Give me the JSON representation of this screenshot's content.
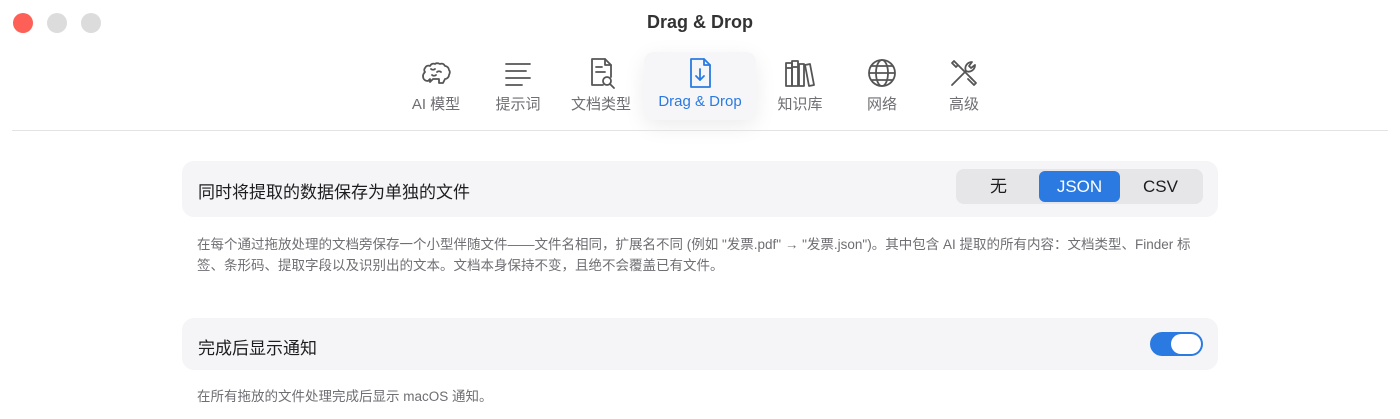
{
  "window": {
    "title": "Drag & Drop"
  },
  "tabs": [
    {
      "label": "AI 模型",
      "icon": "brain-icon",
      "active": false
    },
    {
      "label": "提示词",
      "icon": "text-lines-icon",
      "active": false
    },
    {
      "label": "文档类型",
      "icon": "document-search-icon",
      "active": false
    },
    {
      "label": "Drag & Drop",
      "icon": "document-download-icon",
      "active": true
    },
    {
      "label": "知识库",
      "icon": "books-icon",
      "active": false
    },
    {
      "label": "网络",
      "icon": "globe-icon",
      "active": false
    },
    {
      "label": "高级",
      "icon": "tools-icon",
      "active": false
    }
  ],
  "sections": {
    "save_file": {
      "label": "同时将提取的数据保存为单独的文件",
      "options": [
        "无",
        "JSON",
        "CSV"
      ],
      "selected": "JSON",
      "description": "在每个通过拖放处理的文档旁保存一个小型伴随文件——文件名相同，扩展名不同 (例如 \"发票.pdf\" → \"发票.json\")。其中包含 AI 提取的所有内容：文档类型、Finder 标签、条形码、提取字段以及识别出的文本。文档本身保持不变，且绝不会覆盖已有文件。"
    },
    "notify": {
      "label": "完成后显示通知",
      "enabled": true,
      "description": "在所有拖放的文件处理完成后显示 macOS 通知。"
    }
  },
  "colors": {
    "accent": "#2a7ae2",
    "close": "#fe5f57",
    "row_bg": "#f5f5f7"
  }
}
